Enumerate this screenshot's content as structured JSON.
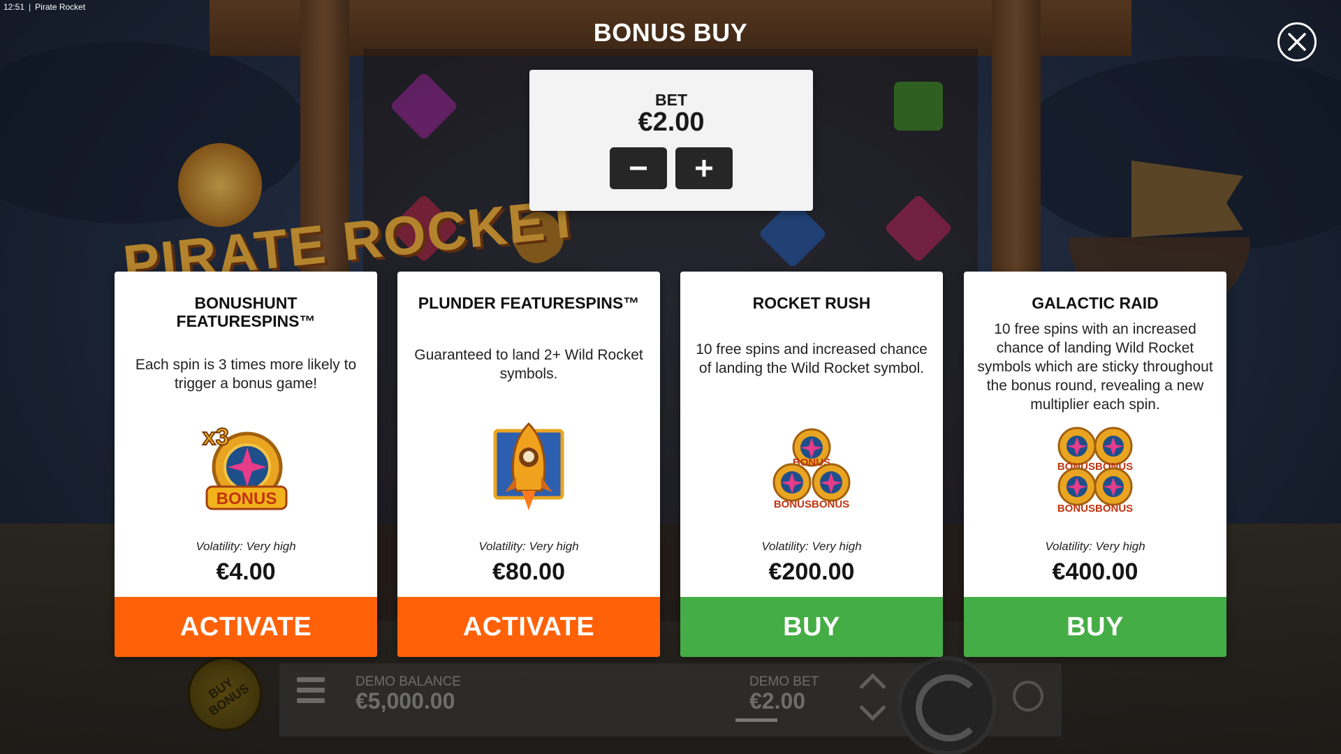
{
  "window": {
    "time": "12:51",
    "separator": "|",
    "app_title": "Pirate Rocket"
  },
  "modal": {
    "title": "BONUS BUY",
    "bet": {
      "label": "BET",
      "value": "€2.00"
    },
    "cards": [
      {
        "title": "BONUSHUNT FEATURESPINS™",
        "description": "Each spin is 3 times more likely to trigger a bonus game!",
        "icon": "x3-bonus-icon",
        "volatility": "Volatility: Very high",
        "price": "€4.00",
        "button": "ACTIVATE"
      },
      {
        "title": "PLUNDER FEATURESPINS™",
        "description": "Guaranteed to land 2+ Wild Rocket symbols.",
        "icon": "wild-rocket-icon",
        "volatility": "Volatility: Very high",
        "price": "€80.00",
        "button": "ACTIVATE"
      },
      {
        "title": "ROCKET RUSH",
        "description": "10 free spins and increased chance of landing the Wild Rocket symbol.",
        "icon": "three-bonus-coins-icon",
        "volatility": "Volatility: Very high",
        "price": "€200.00",
        "button": "BUY"
      },
      {
        "title": "GALACTIC RAID",
        "description": "10 free spins with an increased chance of landing Wild Rocket symbols which are sticky throughout the bonus round, revealing a new multiplier each spin.",
        "icon": "four-bonus-coins-icon",
        "volatility": "Volatility: Very high",
        "price": "€400.00",
        "button": "BUY"
      }
    ]
  },
  "game_logo_text": "PIRATE ROCKET",
  "hud": {
    "buy_bonus_label": "BUY BONUS",
    "balance_label": "DEMO BALANCE",
    "balance_value": "€5,000.00",
    "bet_label": "DEMO BET",
    "bet_value": "€2.00"
  },
  "colors": {
    "activate": "#ff6108",
    "buy": "#45ad45",
    "card_bg": "#ffffff",
    "bet_panel_bg": "#f3f3f3"
  }
}
